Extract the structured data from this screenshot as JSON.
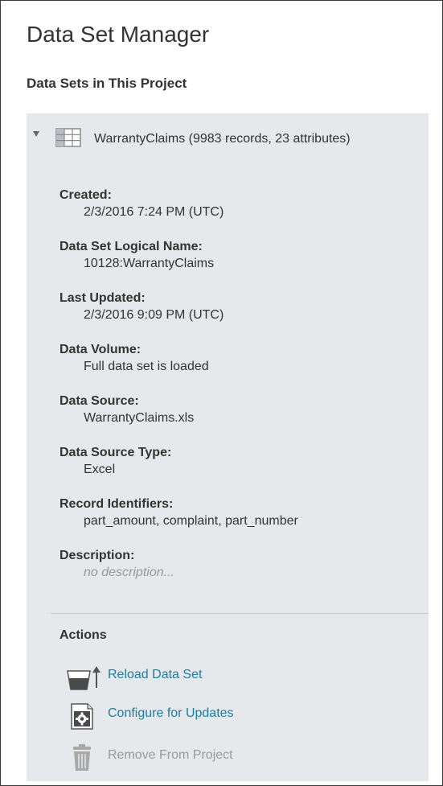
{
  "header": {
    "title": "Data Set Manager",
    "subtitle": "Data Sets in This Project"
  },
  "dataset": {
    "expanded": true,
    "icon": "table-icon",
    "name": "WarrantyClaims (9983 records, 23 attributes)",
    "properties": [
      {
        "label": "Created:",
        "value": "2/3/2016 7:24 PM (UTC)"
      },
      {
        "label": "Data Set Logical Name:",
        "value": "10128:WarrantyClaims"
      },
      {
        "label": "Last Updated:",
        "value": "2/3/2016 9:09 PM (UTC)"
      },
      {
        "label": "Data Volume:",
        "value": "Full data set is loaded"
      },
      {
        "label": "Data Source:",
        "value": "WarrantyClaims.xls"
      },
      {
        "label": "Data Source Type:",
        "value": "Excel"
      },
      {
        "label": "Record Identifiers:",
        "value": "part_amount, complaint, part_number"
      },
      {
        "label": "Description:",
        "value": "no description..."
      }
    ]
  },
  "actions": {
    "heading": "Actions",
    "items": [
      {
        "label": "Reload Data Set",
        "icon": "reload-icon",
        "enabled": true
      },
      {
        "label": "Configure for Updates",
        "icon": "configure-icon",
        "enabled": true
      },
      {
        "label": "Remove From Project",
        "icon": "trash-icon",
        "enabled": false
      }
    ]
  },
  "colors": {
    "panel_bg": "#e6e8eb",
    "link": "#1a7fa0",
    "disabled": "#9a9a9a",
    "text": "#333333",
    "placeholder": "#999999"
  }
}
